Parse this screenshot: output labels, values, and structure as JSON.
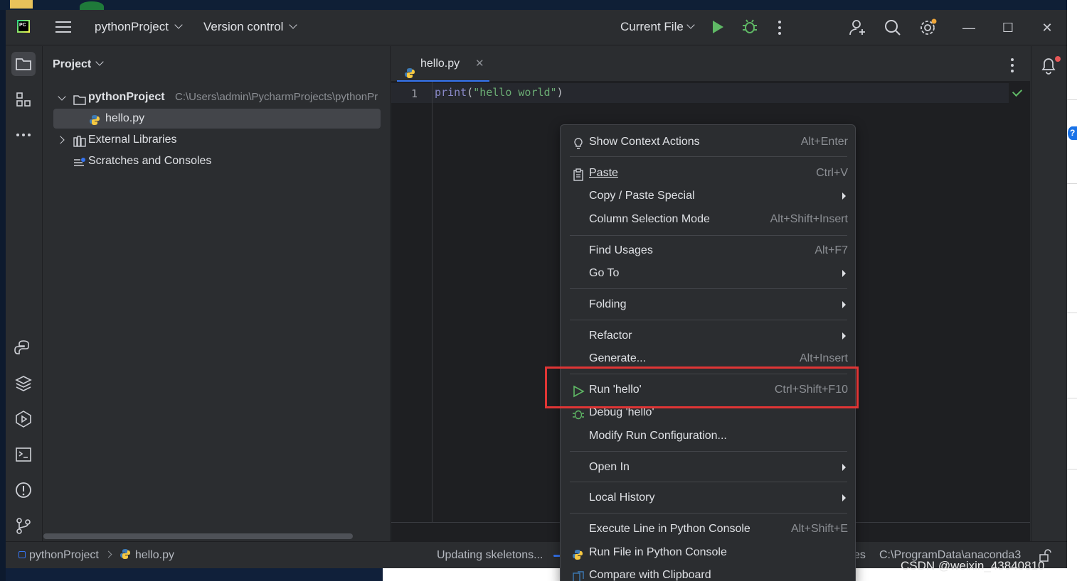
{
  "titlebar": {
    "project_name": "pythonProject",
    "vcs_label": "Version control",
    "run_config": "Current File"
  },
  "project_panel": {
    "title": "Project",
    "tree": [
      {
        "label": "pythonProject",
        "path": "C:\\Users\\admin\\PycharmProjects\\pythonPr"
      },
      {
        "label": "hello.py"
      },
      {
        "label": "External Libraries"
      },
      {
        "label": "Scratches and Consoles"
      }
    ]
  },
  "editor": {
    "tab_label": "hello.py",
    "line_number": "1",
    "code_fn": "print",
    "code_open": "(",
    "code_str": "\"hello world\"",
    "code_close": ")"
  },
  "context_menu": {
    "items": [
      {
        "label": "Show Context Actions",
        "shortcut": "Alt+Enter"
      },
      {
        "label": "Paste",
        "shortcut": "Ctrl+V"
      },
      {
        "label": "Copy / Paste Special",
        "shortcut": ""
      },
      {
        "label": "Column Selection Mode",
        "shortcut": "Alt+Shift+Insert"
      },
      {
        "label": "Find Usages",
        "shortcut": "Alt+F7"
      },
      {
        "label": "Go To",
        "shortcut": ""
      },
      {
        "label": "Folding",
        "shortcut": ""
      },
      {
        "label": "Refactor",
        "shortcut": ""
      },
      {
        "label": "Generate...",
        "shortcut": "Alt+Insert"
      },
      {
        "label": "Run 'hello'",
        "shortcut": "Ctrl+Shift+F10"
      },
      {
        "label": "Debug 'hello'",
        "shortcut": ""
      },
      {
        "label": "Modify Run Configuration...",
        "shortcut": ""
      },
      {
        "label": "Open In",
        "shortcut": ""
      },
      {
        "label": "Local History",
        "shortcut": ""
      },
      {
        "label": "Execute Line in Python Console",
        "shortcut": "Alt+Shift+E"
      },
      {
        "label": "Run File in Python Console",
        "shortcut": ""
      },
      {
        "label": "Compare with Clipboard",
        "shortcut": ""
      }
    ]
  },
  "statusbar": {
    "breadcrumb_project": "pythonProject",
    "breadcrumb_file": "hello.py",
    "progress_text": "Updating skeletons...",
    "es_text": "es",
    "interpreter": "C:\\ProgramData\\anaconda3"
  },
  "watermark": "CSDN @weixin_43840810",
  "colors": {
    "accent": "#3574f0",
    "run_green": "#5fb865",
    "highlight_red": "#e03535",
    "background": "#2b2d30"
  }
}
